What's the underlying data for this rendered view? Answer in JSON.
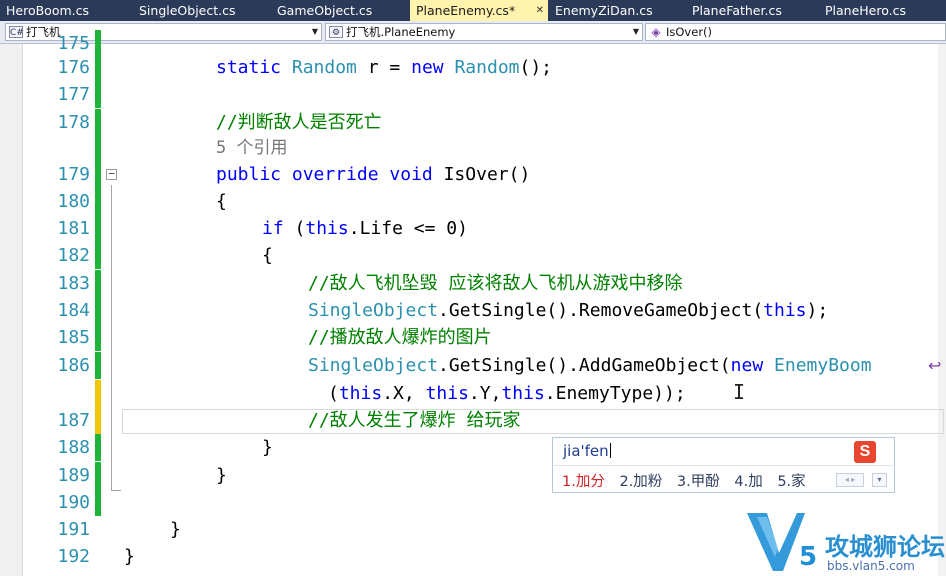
{
  "tabs": [
    {
      "label": "HeroBoom.cs",
      "active": false
    },
    {
      "label": "SingleObject.cs",
      "active": false
    },
    {
      "label": "GameObject.cs",
      "active": false
    },
    {
      "label": "PlaneEnemy.cs*",
      "active": true
    },
    {
      "label": "EnemyZiDan.cs",
      "active": false
    },
    {
      "label": "PlaneFather.cs",
      "active": false
    },
    {
      "label": "PlaneHero.cs",
      "active": false
    }
  ],
  "navbar": {
    "project_combo": "打飞机",
    "class_combo": "打飞机.PlaneEnemy",
    "member_combo": "IsOver()",
    "project_icon": "C#",
    "class_icon": "class-icon",
    "member_icon": "method-icon"
  },
  "code": {
    "l176": {
      "num": "176",
      "parts": [
        "static",
        "Random",
        "r =",
        "new",
        "Random",
        "();"
      ]
    },
    "l177": {
      "num": "177"
    },
    "l178": {
      "num": "178",
      "comment": "//判断敌人是否死亡"
    },
    "refs": "5 个引用",
    "l179": {
      "num": "179",
      "parts": [
        "public override void",
        "IsOver()"
      ]
    },
    "l180": {
      "num": "180",
      "text": "{"
    },
    "l181": {
      "num": "181",
      "parts": [
        "if",
        "(",
        "this",
        ".Life <= 0)"
      ]
    },
    "l182": {
      "num": "182",
      "text": "{"
    },
    "l183": {
      "num": "183",
      "comment": "//敌人飞机坠毁 应该将敌人飞机从游戏中移除"
    },
    "l184": {
      "num": "184",
      "parts": [
        "SingleObject",
        ".GetSingle().RemoveGameObject(",
        "this",
        ");"
      ]
    },
    "l185": {
      "num": "185",
      "comment": "//播放敌人爆炸的图片"
    },
    "l186": {
      "num": "186",
      "parts": [
        "SingleObject",
        ".GetSingle().AddGameObject(",
        "new",
        "EnemyBoom"
      ]
    },
    "l186b": {
      "parts": [
        "(",
        "this",
        ".X, ",
        "this",
        ".Y,",
        "this",
        ".EnemyType));"
      ]
    },
    "l187": {
      "num": "187",
      "comment": "//敌人发生了爆炸 给玩家"
    },
    "l188": {
      "num": "188",
      "text": "}"
    },
    "l189": {
      "num": "189",
      "text": "}"
    },
    "l190": {
      "num": "190"
    },
    "l191": {
      "num": "191",
      "text": "}"
    },
    "l192": {
      "num": "192",
      "text": "}"
    }
  },
  "ime": {
    "pinyin": "jia'fen",
    "candidates": [
      "1.加分",
      "2.加粉",
      "3.甲酚",
      "4.加",
      "5.家"
    ],
    "logo": "S",
    "pager": "◂ ▸",
    "menu": "▾"
  },
  "watermark": {
    "title": "攻城狮论坛",
    "sub": "bbs.vlan5.com",
    "logo_letter": "V5"
  },
  "colors": {
    "tab_bar": "#2b3a58",
    "active_tab": "#fff3ae",
    "keyword": "#0000ff",
    "type": "#2b91af",
    "comment": "#008000",
    "change_saved": "#1fb33a",
    "change_unsaved": "#f2c40a"
  }
}
